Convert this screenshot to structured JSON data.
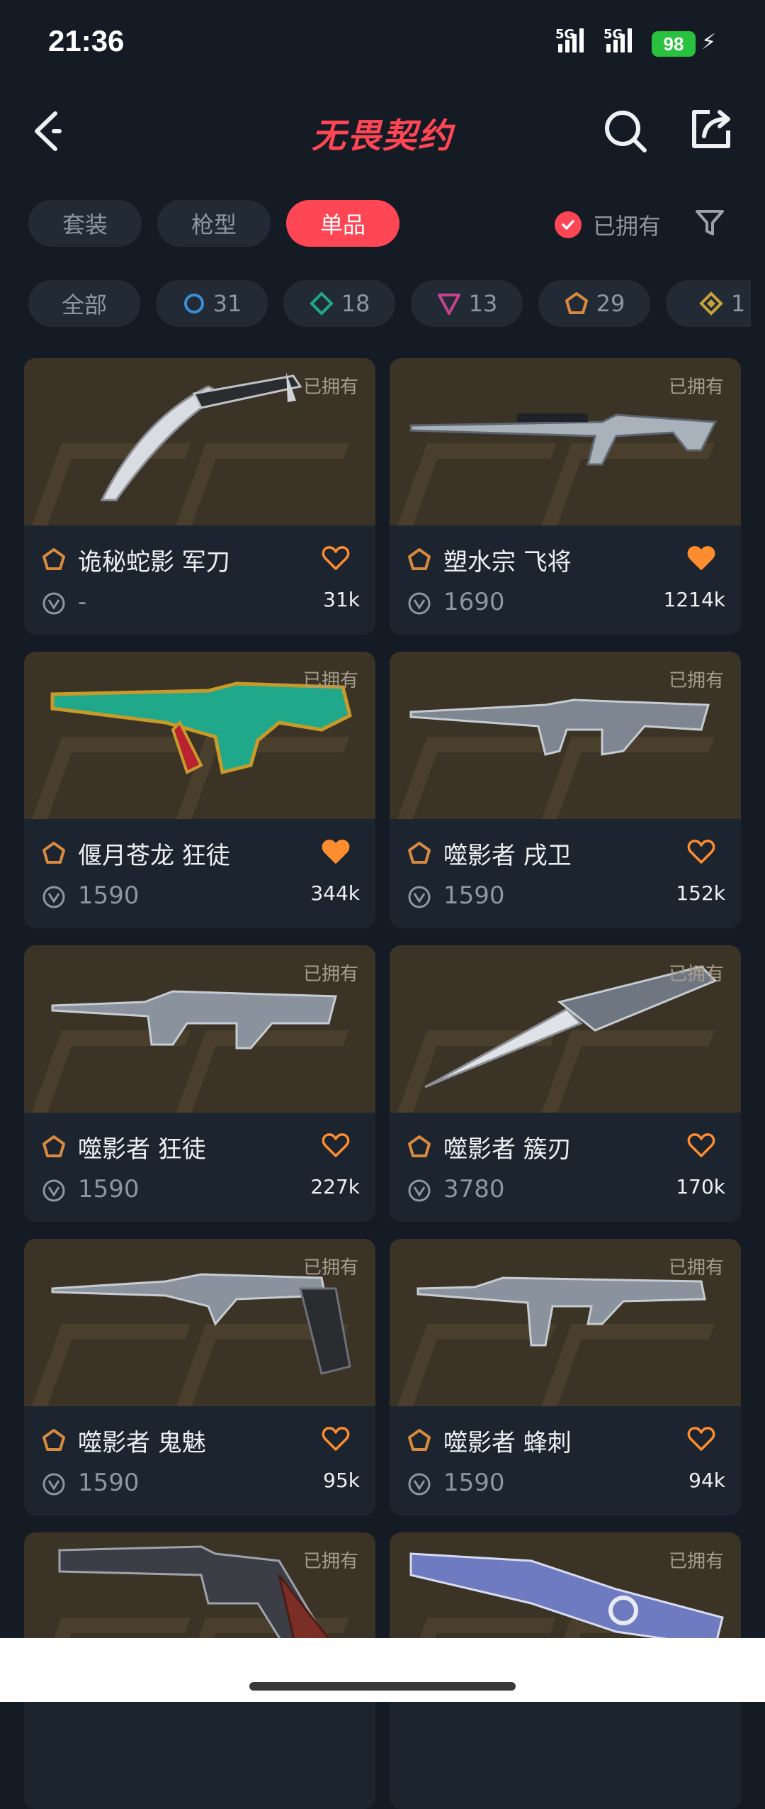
{
  "status": {
    "time": "21:36",
    "signal1": "5G",
    "signal2": "5G",
    "battery": "98"
  },
  "header": {
    "title": "无畏契约"
  },
  "tabs": [
    {
      "label": "套装",
      "active": false
    },
    {
      "label": "枪型",
      "active": false
    },
    {
      "label": "单品",
      "active": true
    }
  ],
  "owned_filter": {
    "label": "已拥有",
    "checked": true
  },
  "tiers": [
    {
      "label": "全部",
      "icon": ""
    },
    {
      "label": "31",
      "icon": "select-tier-icon",
      "color": "#3a8fd6"
    },
    {
      "label": "18",
      "icon": "deluxe-tier-icon",
      "color": "#1fa88a"
    },
    {
      "label": "13",
      "icon": "premium-tier-icon",
      "color": "#c4448b"
    },
    {
      "label": "29",
      "icon": "exclusive-tier-icon",
      "color": "#d98a3e"
    },
    {
      "label": "1",
      "icon": "ultra-tier-icon",
      "color": "#c8a23a"
    }
  ],
  "items": [
    {
      "name": "诡秘蛇影 军刀",
      "owned": "已拥有",
      "price": "-",
      "likes": "31k",
      "liked": false
    },
    {
      "name": "塑水宗 飞将",
      "owned": "已拥有",
      "price": "1690",
      "likes": "1214k",
      "liked": true
    },
    {
      "name": "偃月苍龙 狂徒",
      "owned": "已拥有",
      "price": "1590",
      "likes": "344k",
      "liked": true
    },
    {
      "name": "噬影者 戌卫",
      "owned": "已拥有",
      "price": "1590",
      "likes": "152k",
      "liked": false
    },
    {
      "name": "噬影者 狂徒",
      "owned": "已拥有",
      "price": "1590",
      "likes": "227k",
      "liked": false
    },
    {
      "name": "噬影者 簇刃",
      "owned": "已拥有",
      "price": "3780",
      "likes": "170k",
      "liked": false
    },
    {
      "name": "噬影者 鬼魅",
      "owned": "已拥有",
      "price": "1590",
      "likes": "95k",
      "liked": false
    },
    {
      "name": "噬影者 蜂刺",
      "owned": "已拥有",
      "price": "1590",
      "likes": "94k",
      "liked": false
    },
    {
      "owned": "已拥有"
    },
    {
      "owned": "已拥有"
    }
  ],
  "colors": {
    "accent": "#ff4655",
    "heart": "#ff8c2e",
    "tier_exclusive": "#d98a3e"
  }
}
